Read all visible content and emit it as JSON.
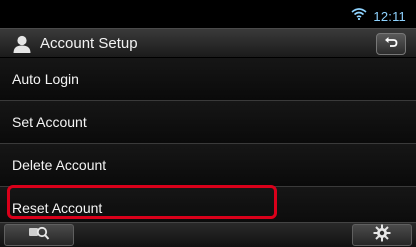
{
  "status": {
    "time": "12:11",
    "wifi_icon": "wifi-icon",
    "time_color": "#8fd3ff"
  },
  "header": {
    "title": "Account Setup",
    "user_icon": "user-icon",
    "back_icon": "back-arrow-icon"
  },
  "menu": {
    "items": [
      {
        "label": "Auto Login"
      },
      {
        "label": "Set Account"
      },
      {
        "label": "Delete Account"
      },
      {
        "label": "Reset Account"
      }
    ],
    "highlight_color": "#d9001a"
  },
  "bottom": {
    "left_icon": "search-icon",
    "right_icon": "gear-icon"
  }
}
